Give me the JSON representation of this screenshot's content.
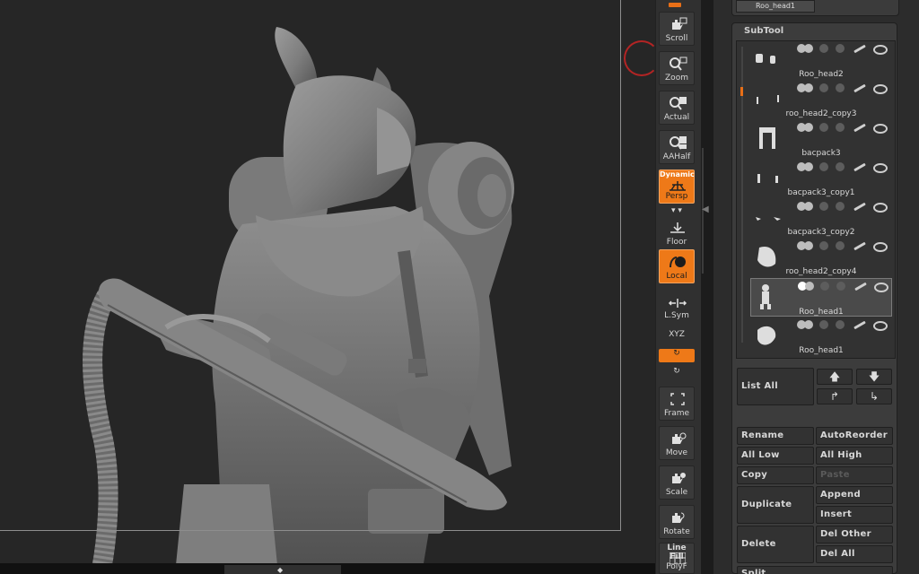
{
  "shelf": {
    "scroll": "Scroll",
    "zoom": "Zoom",
    "actual": "Actual",
    "aahalf": "AAHalf",
    "dynamic": "Dynamic",
    "persp": "Persp",
    "floor": "Floor",
    "local": "Local",
    "lsym": "L.Sym",
    "xyz": "XYZ",
    "frame": "Frame",
    "move": "Move",
    "scale": "Scale",
    "rotate": "Rotate",
    "linefill": "Line Fill",
    "polyf": "PolyF"
  },
  "palette": {
    "top_thumb": "Roo_head1",
    "subtool_title": "SubTool",
    "subtools": [
      {
        "name": "Roo_head2"
      },
      {
        "name": "roo_head2_copy3"
      },
      {
        "name": "bacpack3"
      },
      {
        "name": "bacpack3_copy1"
      },
      {
        "name": "bacpack3_copy2"
      },
      {
        "name": "roo_head2_copy4"
      },
      {
        "name": "Roo_head1",
        "selected": true
      },
      {
        "name": "Roo_head1"
      }
    ],
    "list_all": "List All",
    "rename": "Rename",
    "autoreorder": "AutoReorder",
    "all_low": "All Low",
    "all_high": "All High",
    "copy": "Copy",
    "paste": "Paste",
    "duplicate": "Duplicate",
    "append": "Append",
    "insert": "Insert",
    "delete": "Delete",
    "del_other": "Del Other",
    "del_all": "Del All",
    "split": "Split"
  },
  "colors": {
    "accent": "#ee7918",
    "canvas": "#262626",
    "panel": "#3c3c3c"
  }
}
